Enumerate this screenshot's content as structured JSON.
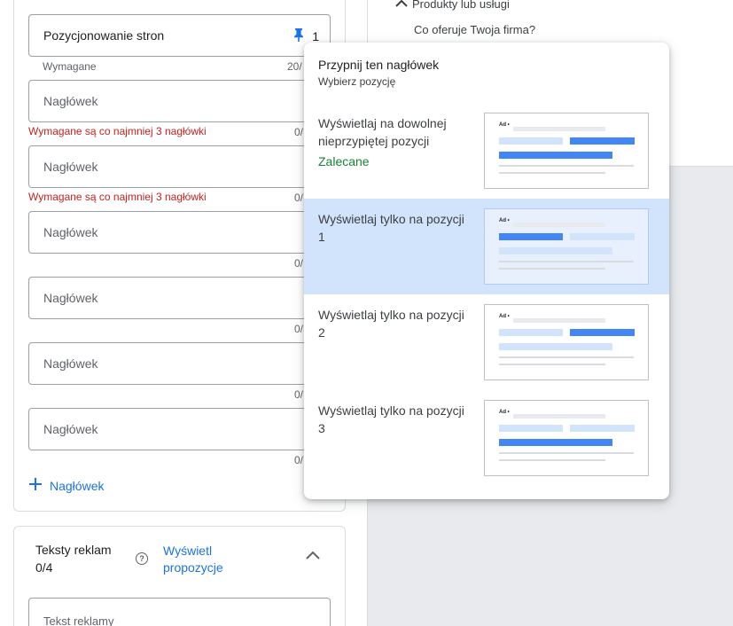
{
  "right_panel": {
    "products_heading": "Produkty lub usługi",
    "products_question": "Co oferuje Twoja firma?"
  },
  "headlines": {
    "fields": [
      {
        "text": "Pozycjonowanie stron",
        "pinned": true,
        "pin_position": "1",
        "helper": "Wymagane",
        "helper_type": "info",
        "counter": "20/"
      },
      {
        "text": "Nagłówek",
        "pinned": false,
        "helper": "Wymagane są co najmniej 3 nagłówki",
        "helper_type": "error",
        "counter": "0/"
      },
      {
        "text": "Nagłówek",
        "pinned": false,
        "helper": "Wymagane są co najmniej 3 nagłówki",
        "helper_type": "error",
        "counter": "0/"
      },
      {
        "text": "Nagłówek",
        "pinned": false,
        "helper": "",
        "counter": "0/"
      },
      {
        "text": "Nagłówek",
        "pinned": false,
        "helper": "",
        "counter": "0/"
      },
      {
        "text": "Nagłówek",
        "pinned": false,
        "helper": "",
        "counter": "0/"
      },
      {
        "text": "Nagłówek",
        "pinned": false,
        "helper": "",
        "counter": "0/"
      }
    ],
    "add_button_label": "Nagłówek"
  },
  "descriptions": {
    "title": "Teksty reklam",
    "count": "0/4",
    "link_label": "Wyświetl propozycje",
    "field_placeholder": "Tekst reklamy"
  },
  "pin_popup": {
    "title": "Przypnij ten nagłówek",
    "subtitle": "Wybierz pozycję",
    "options": [
      {
        "label": "Wyświetlaj na dowolnej nieprzypiętej pozycji",
        "badge": "Zalecane",
        "selected": false,
        "highlight": "none"
      },
      {
        "label": "Wyświetlaj tylko na pozycji 1",
        "badge": "",
        "selected": true,
        "highlight": "1"
      },
      {
        "label": "Wyświetlaj tylko na pozycji 2",
        "badge": "",
        "selected": false,
        "highlight": "2"
      },
      {
        "label": "Wyświetlaj tylko na pozycji 3",
        "badge": "",
        "selected": false,
        "highlight": "3"
      }
    ],
    "preview_ad_label": "Ad •"
  },
  "colors": {
    "accent_blue": "#1a73e8",
    "error_red": "#c5221f",
    "recommended_green": "#188038",
    "selected_bg": "#d2e3fc"
  }
}
